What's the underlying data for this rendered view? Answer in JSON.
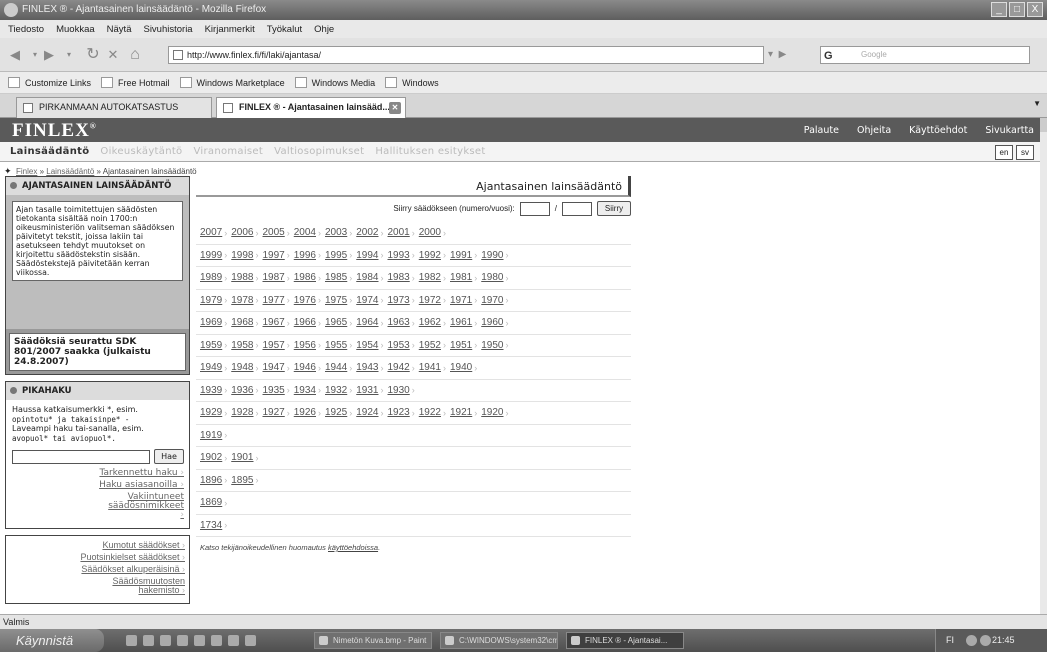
{
  "window": {
    "title": "FINLEX ® - Ajantasainen lainsäädäntö - Mozilla Firefox",
    "controls": [
      "_",
      "□",
      "X"
    ]
  },
  "menu": [
    "Tiedosto",
    "Muokkaa",
    "Näytä",
    "Sivuhistoria",
    "Kirjanmerkit",
    "Työkalut",
    "Ohje"
  ],
  "nav": {
    "url": "http://www.finlex.fi/fi/laki/ajantasa/",
    "search_placeholder": "Google",
    "search_engine_letter": "G"
  },
  "bookmarks": [
    "Customize Links",
    "Free Hotmail",
    "Windows Marketplace",
    "Windows Media",
    "Windows"
  ],
  "tabs": [
    {
      "label": "PIRKANMAAN AUTOKATSASTUS",
      "active": false
    },
    {
      "label": "FINLEX ® - Ajantasainen lainsääd...",
      "active": true
    }
  ],
  "site": {
    "logo": "FINLEX",
    "reg": "®",
    "header_links": [
      "Palaute",
      "Ohjeita",
      "Käyttöehdot",
      "Sivukartta"
    ],
    "subnav": [
      "Lainsäädäntö",
      "Oikeuskäytäntö",
      "Viranomaiset",
      "Valtiosopimukset",
      "Hallituksen esitykset"
    ],
    "langs": [
      "en",
      "sv"
    ]
  },
  "breadcrumb": {
    "items": [
      "Finlex",
      "Lainsäädäntö"
    ],
    "current": "Ajantasainen lainsäädäntö",
    "sep": "»"
  },
  "sidebar": {
    "ajantasa_title": "AJANTASAINEN LAINSÄÄDÄNTÖ",
    "ajantasa_text": "Ajan tasalle toimitettujen säädösten tietokanta sisältää noin 1700:n oikeusministeriön valitseman säädöksen päivitetyt tekstit, joissa lakiin tai asetukseen tehdyt muutokset on kirjoitettu säädöstekstin sisään. Säädöstekstejä päivitetään kerran viikossa.",
    "followup": "Säädöksiä seurattu SDK 801/2007 saakka (julkaistu 24.8.2007)",
    "pikahaku_title": "PIKAHAKU",
    "pikahaku_text1": "Haussa katkaisumerkki *, esim.",
    "pikahaku_mono": "opintotu* ja takaisinpe* -",
    "pikahaku_text2": "Laveampi haku tai-sanalla, esim.",
    "pikahaku_mono2": "avopuol* tai aviopuol*.",
    "search_button": "Hae",
    "links": [
      "Tarkennettu haku",
      "Haku asiasanoilla",
      "Vakiintuneet säädösnimikkeet"
    ],
    "lower_links": [
      "Kumotut säädökset",
      "Puotsinkielset säädökset",
      "Säädökset alkuperäisinä",
      "Säädösmuutosten hakemisto"
    ]
  },
  "main": {
    "title": "Ajantasainen lainsäädäntö",
    "goto_label": "Siirry säädökseen (numero/vuosi):",
    "goto_slash": "/",
    "goto_button": "Siirry",
    "year_rows": [
      [
        "2007",
        "2006",
        "2005",
        "2004",
        "2003",
        "2002",
        "2001",
        "2000"
      ],
      [
        "1999",
        "1998",
        "1997",
        "1996",
        "1995",
        "1994",
        "1993",
        "1992",
        "1991",
        "1990"
      ],
      [
        "1989",
        "1988",
        "1987",
        "1986",
        "1985",
        "1984",
        "1983",
        "1982",
        "1981",
        "1980"
      ],
      [
        "1979",
        "1978",
        "1977",
        "1976",
        "1975",
        "1974",
        "1973",
        "1972",
        "1971",
        "1970"
      ],
      [
        "1969",
        "1968",
        "1967",
        "1966",
        "1965",
        "1964",
        "1963",
        "1962",
        "1961",
        "1960"
      ],
      [
        "1959",
        "1958",
        "1957",
        "1956",
        "1955",
        "1954",
        "1953",
        "1952",
        "1951",
        "1950"
      ],
      [
        "1949",
        "1948",
        "1947",
        "1946",
        "1944",
        "1943",
        "1942",
        "1941",
        "1940"
      ],
      [
        "1939",
        "1936",
        "1935",
        "1934",
        "1932",
        "1931",
        "1930"
      ],
      [
        "1929",
        "1928",
        "1927",
        "1926",
        "1925",
        "1924",
        "1923",
        "1922",
        "1921",
        "1920"
      ],
      [
        "1919"
      ],
      [
        "1902",
        "1901"
      ],
      [
        "1896",
        "1895"
      ],
      [
        "1869"
      ],
      [
        "1734"
      ]
    ],
    "note_prefix": "Katso tekijänoikeudellinen huomautus",
    "note_link": "käyttöehdoissa",
    "note_suffix": "."
  },
  "status": "Valmis",
  "taskbar": {
    "start": "Käynnistä",
    "buttons": [
      {
        "label": "Nimetön Kuva.bmp - Paint",
        "active": false
      },
      {
        "label": "C:\\WINDOWS\\system32\\cmd.exe",
        "active": false
      },
      {
        "label": "FINLEX ® - Ajantasai...",
        "active": true
      }
    ],
    "lang": "FI",
    "clock": "21:45"
  }
}
